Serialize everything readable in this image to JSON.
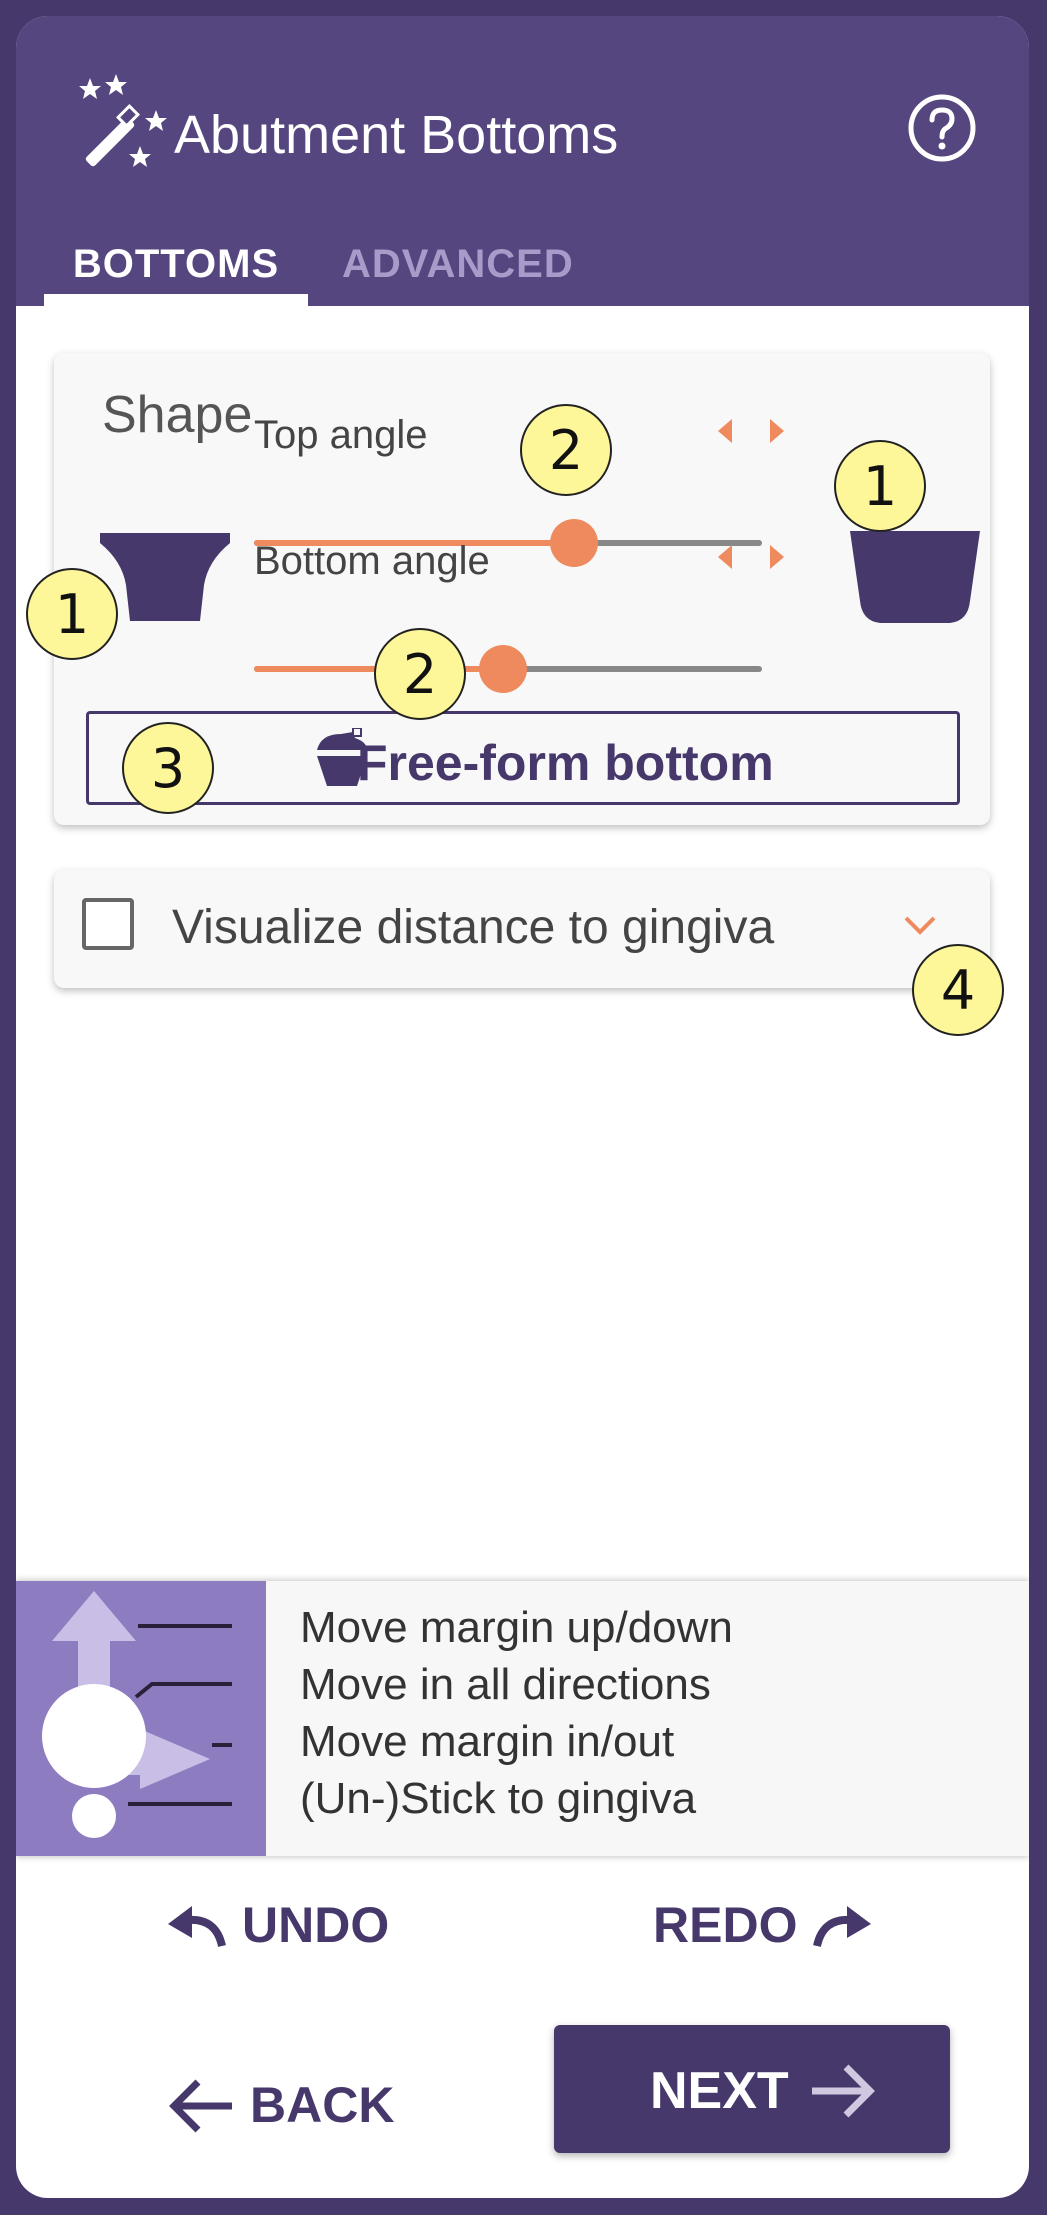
{
  "header": {
    "title": "Abutment Bottoms",
    "tabs": [
      {
        "label": "BOTTOMS",
        "active": true
      },
      {
        "label": "ADVANCED",
        "active": false
      }
    ],
    "help_icon": "help-circle-icon",
    "wand_icon": "magic-wand-icon"
  },
  "shape": {
    "heading": "Shape",
    "top_angle": {
      "label": "Top angle",
      "value": 0.63
    },
    "bottom_angle": {
      "label": "Bottom angle",
      "value": 0.49
    },
    "freeform_label": "Free-form bottom"
  },
  "visualize": {
    "label": "Visualize distance to gingiva",
    "checked": false
  },
  "callouts": [
    "1",
    "2",
    "1",
    "2",
    "3",
    "4"
  ],
  "hints": [
    "Move margin up/down",
    "Move in all directions",
    "Move margin in/out",
    "(Un-)Stick to gingiva"
  ],
  "actions": {
    "undo": "UNDO",
    "redo": "REDO",
    "back": "BACK",
    "next": "NEXT"
  },
  "colors": {
    "primary": "#47386b",
    "header": "#55467f",
    "accent": "#ee8a5e",
    "callout": "#fdf79a"
  }
}
